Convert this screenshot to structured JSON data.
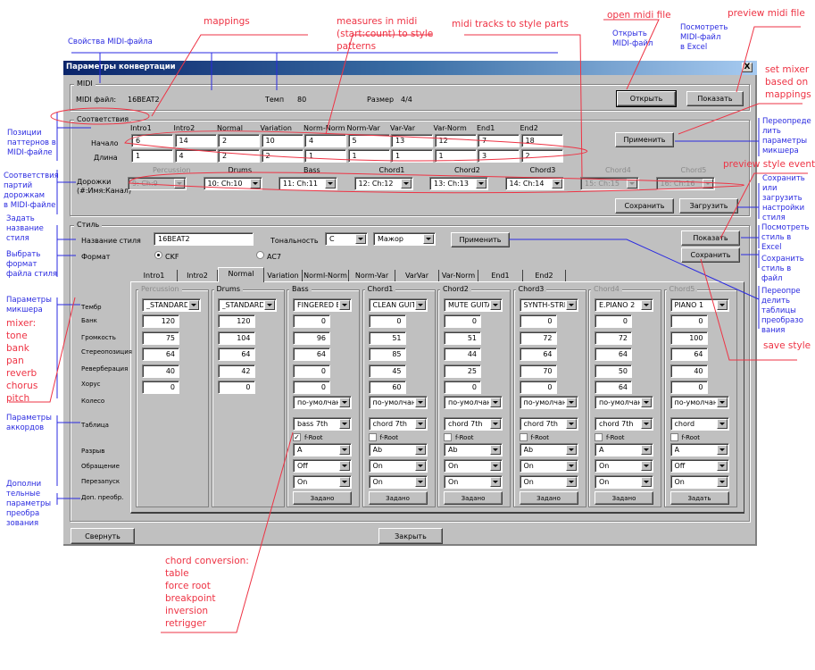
{
  "window": {
    "title": "Параметры конвертации",
    "close_label": "X"
  },
  "midi": {
    "group_label": "MIDI",
    "file_label": "MIDI файл:",
    "file_value": "16BEAT2",
    "tempo_label": "Темп",
    "tempo_value": "80",
    "size_label": "Размер",
    "size_value": "4/4",
    "open_button": "Открыть",
    "show_button": "Показать"
  },
  "mappings": {
    "group_label": "Соответствия",
    "columns": [
      "Intro1",
      "Intro2",
      "Normal",
      "Variation",
      "Norm-Norm",
      "Norm-Var",
      "Var-Var",
      "Var-Norm",
      "End1",
      "End2"
    ],
    "start_label": "Начало",
    "length_label": "Длина",
    "start_values": [
      "6",
      "14",
      "2",
      "10",
      "4",
      "5",
      "13",
      "12",
      "7",
      "18"
    ],
    "length_values": [
      "1",
      "4",
      "2",
      "2",
      "1",
      "1",
      "1",
      "1",
      "3",
      "2"
    ],
    "apply_button": "Применить",
    "tracks_label_1": "Дорожки",
    "tracks_label_2": "(#:Имя:Канал)",
    "tracks": [
      {
        "part": "Percussion",
        "value": "9:  Ch:9",
        "enabled": false
      },
      {
        "part": "Drums",
        "value": "10:  Ch:10",
        "enabled": true
      },
      {
        "part": "Bass",
        "value": "11:  Ch:11",
        "enabled": true
      },
      {
        "part": "Chord1",
        "value": "12:  Ch:12",
        "enabled": true
      },
      {
        "part": "Chord2",
        "value": "13:  Ch:13",
        "enabled": true
      },
      {
        "part": "Chord3",
        "value": "14:  Ch:14",
        "enabled": true
      },
      {
        "part": "Chord4",
        "value": "15:  Ch:15",
        "enabled": false
      },
      {
        "part": "Chord5",
        "value": "16:  Ch:16",
        "enabled": false
      }
    ],
    "save_button": "Сохранить",
    "load_button": "Загрузить"
  },
  "style": {
    "group_label": "Стиль",
    "name_label": "Название стиля",
    "name_value": "16BEAT2",
    "key_label": "Тональность",
    "key_value": "C",
    "mode_value": "Мажор",
    "apply_button": "Применить",
    "show_button": "Показать",
    "save_button": "Сохранить",
    "format_label": "Формат",
    "format_options": [
      "CKF",
      "AC7"
    ],
    "format_selected": "CKF",
    "tabs": [
      "Intro1",
      "Intro2",
      "Normal",
      "Variation",
      "Norml-Norm",
      "Norm-Var",
      "VarVar",
      "Var-Norm",
      "End1",
      "End2"
    ],
    "active_tab": "Normal",
    "row_labels": [
      "Тембр",
      "Банк",
      "Громкость",
      "Стереопозиция",
      "Реверберация",
      "Хорус",
      "Колесо",
      "Таблица",
      "Разрыв",
      "Обращение",
      "Перезапуск",
      "Доп. преобр."
    ],
    "froot_label": "f-Root",
    "parts": [
      {
        "name": "Percussion",
        "enabled": false,
        "tone": "_STANDARD",
        "bank": "120",
        "volume": "75",
        "pan": "64",
        "reverb": "40",
        "chorus": "0"
      },
      {
        "name": "Drums",
        "enabled": true,
        "tone": "_STANDARD",
        "bank": "120",
        "volume": "104",
        "pan": "64",
        "reverb": "42",
        "chorus": "0"
      },
      {
        "name": "Bass",
        "enabled": true,
        "tone": "FINGERED B",
        "bank": "0",
        "volume": "96",
        "pan": "64",
        "reverb": "0",
        "chorus": "0",
        "wheel": "по-умолчани",
        "table": "bass 7th",
        "froot": true,
        "break": "A",
        "inversion": "Off",
        "retrigger": "On",
        "extra": "Задано"
      },
      {
        "name": "Chord1",
        "enabled": true,
        "tone": "CLEAN GUIT",
        "bank": "0",
        "volume": "51",
        "pan": "85",
        "reverb": "45",
        "chorus": "60",
        "wheel": "по-умолчани",
        "table": "chord 7th",
        "froot": false,
        "break": "Ab",
        "inversion": "On",
        "retrigger": "On",
        "extra": "Задано"
      },
      {
        "name": "Chord2",
        "enabled": true,
        "tone": "MUTE GUITA",
        "bank": "0",
        "volume": "51",
        "pan": "44",
        "reverb": "25",
        "chorus": "0",
        "wheel": "по-умолчани",
        "table": "chord 7th",
        "froot": false,
        "break": "Ab",
        "inversion": "On",
        "retrigger": "On",
        "extra": "Задано"
      },
      {
        "name": "Chord3",
        "enabled": true,
        "tone": "SYNTH-STRI",
        "bank": "0",
        "volume": "72",
        "pan": "64",
        "reverb": "70",
        "chorus": "0",
        "wheel": "по-умолчани",
        "table": "chord 7th",
        "froot": false,
        "break": "Ab",
        "inversion": "On",
        "retrigger": "On",
        "extra": "Задано"
      },
      {
        "name": "Chord4",
        "enabled": false,
        "tone": "E.PIANO 2",
        "bank": "0",
        "volume": "72",
        "pan": "64",
        "reverb": "50",
        "chorus": "64",
        "wheel": "по-умолчани",
        "table": "chord 7th",
        "froot": false,
        "break": "A",
        "inversion": "On",
        "retrigger": "On",
        "extra": "Задано"
      },
      {
        "name": "Chord5",
        "enabled": false,
        "tone": "PIANO 1",
        "bank": "0",
        "volume": "100",
        "pan": "64",
        "reverb": "40",
        "chorus": "0",
        "wheel": "по-умолчани",
        "table": "chord",
        "froot": false,
        "break": "A",
        "inversion": "Off",
        "retrigger": "On",
        "extra": "Задать"
      }
    ]
  },
  "footer": {
    "collapse_button": "Свернуть",
    "close_button": "Закрыть"
  },
  "annotations": {
    "red": {
      "mappings": "mappings",
      "measures": [
        "measures in midi",
        "(start:count) to style",
        "patterns"
      ],
      "tracks": "midi tracks to style parts",
      "open": "open midi file",
      "preview_midi": "preview midi file",
      "set_mixer": [
        "set mixer",
        "based on",
        "mappings"
      ],
      "preview_style": "preview style events",
      "save_style": "save style",
      "mixer": [
        "mixer:",
        "tone",
        "bank",
        "pan",
        "reverb",
        "chorus",
        "pitch"
      ],
      "chord_conv": [
        "chord conversion:",
        "table",
        "force root",
        "breakpoint",
        "inversion",
        "retrigger"
      ]
    },
    "blue": {
      "midi_props": "Свойства MIDI-файла",
      "open_midi": [
        "Открыть",
        "MIDI-файл"
      ],
      "view_excel": [
        "Посмотреть",
        "MIDI-файл",
        "в Excel"
      ],
      "positions": [
        "Позиции",
        "паттернов в",
        "MIDI-файле"
      ],
      "parts_tracks": [
        "Соответствия",
        "партий",
        "дорожкам",
        "в MIDI-файле"
      ],
      "set_name": [
        "Задать",
        "название",
        "стиля"
      ],
      "format": [
        "Выбрать",
        "формат",
        "файла стиля"
      ],
      "mixer_params": [
        "Параметры",
        "микшера"
      ],
      "chord_params": [
        "Параметры",
        "аккордов"
      ],
      "extra_params": [
        "Дополни",
        "тельные",
        "параметры",
        "преобра",
        "зования"
      ],
      "override_mixer": [
        "Переопреде",
        "лить",
        "параметры",
        "микшера"
      ],
      "save_load": [
        "Сохранить",
        "или",
        "загрузить",
        "настройки",
        "стиля"
      ],
      "view_style": [
        "Посмотреть",
        "стиль в",
        "Excel"
      ],
      "save_file": [
        "Сохранить",
        "стиль в",
        "файл"
      ],
      "override_tables": [
        "Переопре",
        "делить",
        "таблицы",
        "преобразо",
        "вания"
      ]
    }
  }
}
